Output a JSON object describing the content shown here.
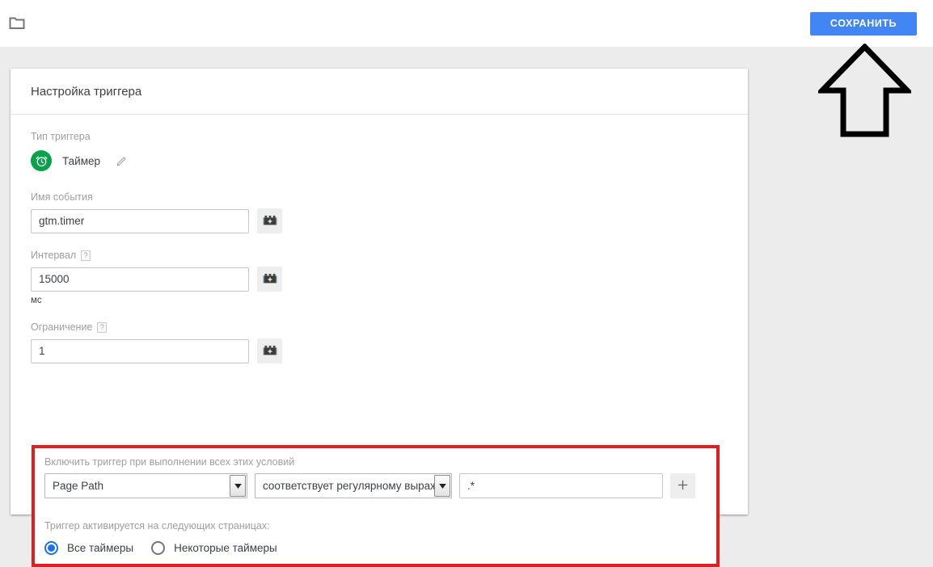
{
  "topbar": {
    "folder_icon": "folder-icon",
    "save_label": "СОХРАНИТЬ",
    "save_color": "#4285f4"
  },
  "annotation": {
    "arrow_icon": "up-arrow-icon",
    "arrow_color": "#000000"
  },
  "card": {
    "title": "Настройка триггера",
    "trigger_type": {
      "label": "Тип триггера",
      "icon": "alarm-clock-icon",
      "icon_color": "#0aa14b",
      "name": "Таймер",
      "edit_icon": "pencil-icon"
    },
    "event_name": {
      "label": "Имя события",
      "value": "gtm.timer",
      "placeholder": "",
      "picker_icon": "lego-brick-plus-icon"
    },
    "interval": {
      "label": "Интервал",
      "help": "?",
      "value": "15000",
      "placeholder": "",
      "unit": "мс",
      "picker_icon": "lego-brick-plus-icon"
    },
    "limit": {
      "label": "Ограничение",
      "help": "?",
      "value": "1",
      "placeholder": "",
      "picker_icon": "lego-brick-plus-icon"
    },
    "conditions": {
      "highlight_color": "#e02020",
      "label": "Включить триггер при выполнении всех этих условий",
      "variable_selected": "Page Path",
      "operator_selected": "соответствует регулярному выражению",
      "value": ".*",
      "value_placeholder": "",
      "add_label": "+",
      "dropdown_icon": "chevron-down-icon",
      "add_icon": "plus-icon"
    },
    "fire_on": {
      "label": "Триггер активируется на следующих страницах:",
      "options": [
        {
          "label": "Все таймеры",
          "selected": true
        },
        {
          "label": "Некоторые таймеры",
          "selected": false
        }
      ]
    }
  }
}
